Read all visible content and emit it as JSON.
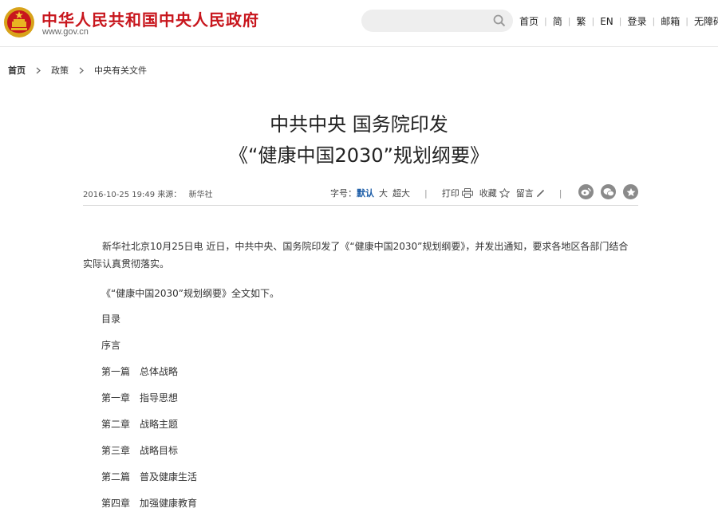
{
  "header": {
    "site_title": "中华人民共和国中央人民政府",
    "site_domain": "www.gov.cn",
    "search": {
      "value": "",
      "placeholder": ""
    },
    "nav": [
      "首页",
      "简",
      "繁",
      "EN",
      "登录",
      "邮箱",
      "无障碍"
    ]
  },
  "breadcrumb": [
    "首页",
    "政策",
    "中央有关文件"
  ],
  "article": {
    "title_line1": "中共中央 国务院印发",
    "title_line2": "《“健康中国2030”规划纲要》",
    "datetime": "2016-10-25 19:49",
    "source_label": "来源：",
    "source": "新华社",
    "font_size_label": "字号：",
    "font_sizes": [
      "默认",
      "大",
      "超大"
    ],
    "print_label": "打印",
    "collect_label": "收藏",
    "comment_label": "留言",
    "paragraphs": [
      "新华社北京10月25日电  近日，中共中央、国务院印发了《“健康中国2030”规划纲要》，并发出通知，要求各地区各部门结合实际认真贯彻落实。",
      "《“健康中国2030”规划纲要》全文如下。"
    ],
    "toc": [
      "目录",
      "序言",
      "第一篇　总体战略",
      "第一章　指导思想",
      "第二章　战略主题",
      "第三章　战略目标",
      "第二篇　普及健康生活",
      "第四章　加强健康教育"
    ]
  },
  "colors": {
    "brand_red": "#c8161d",
    "accent_blue": "#1e5ea8",
    "share_gray": "#8a8a8a"
  },
  "icons": [
    "national-emblem",
    "search-icon",
    "chevron-right-icon",
    "printer-icon",
    "star-icon",
    "pencil-icon",
    "weibo-icon",
    "wechat-icon",
    "favorite-icon"
  ]
}
